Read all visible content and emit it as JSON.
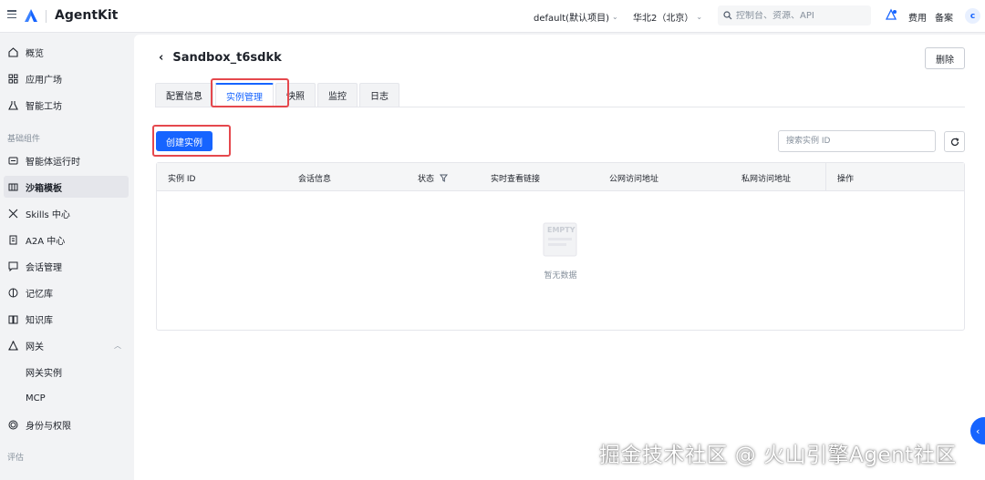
{
  "app": {
    "title": "AgentKit"
  },
  "topbar": {
    "project": "default(默认项目)",
    "region": "华北2（北京）",
    "search_placeholder": "控制台、资源、API",
    "fee": "费用",
    "beian": "备案",
    "avatar": "c"
  },
  "sidebar": {
    "top_items": [
      {
        "label": "概览",
        "icon": "home-icon"
      },
      {
        "label": "应用广场",
        "icon": "apps-grid-icon"
      },
      {
        "label": "智能工坊",
        "icon": "flask-icon"
      }
    ],
    "group_basic": "基础组件",
    "basic_items": [
      {
        "label": "智能体运行时",
        "icon": "runtime-icon"
      },
      {
        "label": "沙箱模板",
        "icon": "sandbox-icon",
        "active": true
      },
      {
        "label": "Skills 中心",
        "icon": "skills-icon"
      },
      {
        "label": "A2A 中心",
        "icon": "a2a-icon"
      },
      {
        "label": "会话管理",
        "icon": "chat-icon"
      },
      {
        "label": "记忆库",
        "icon": "brain-icon"
      },
      {
        "label": "知识库",
        "icon": "book-icon"
      },
      {
        "label": "网关",
        "icon": "gateway-icon"
      }
    ],
    "gateway_sub": [
      "网关实例",
      "MCP"
    ],
    "identity": {
      "label": "身份与权限",
      "icon": "fingerprint-icon"
    },
    "group_next": "评估"
  },
  "page": {
    "title": "Sandbox_t6sdkk",
    "delete_label": "删除",
    "tabs": [
      "配置信息",
      "实例管理",
      "快照",
      "监控",
      "日志"
    ],
    "active_tab": "实例管理",
    "create_label": "创建实例",
    "search_placeholder": "搜索实例 ID"
  },
  "table": {
    "columns": [
      "实例 ID",
      "会话信息",
      "状态",
      "实时查看链接",
      "公网访问地址",
      "私网访问地址",
      "操作"
    ],
    "empty_badge": "EMPTY",
    "empty_text": "暂无数据"
  },
  "watermark": "掘金技术社区 @ 火山引擎Agent社区",
  "colors": {
    "primary": "#1664ff",
    "highlight": "#e5484d"
  }
}
